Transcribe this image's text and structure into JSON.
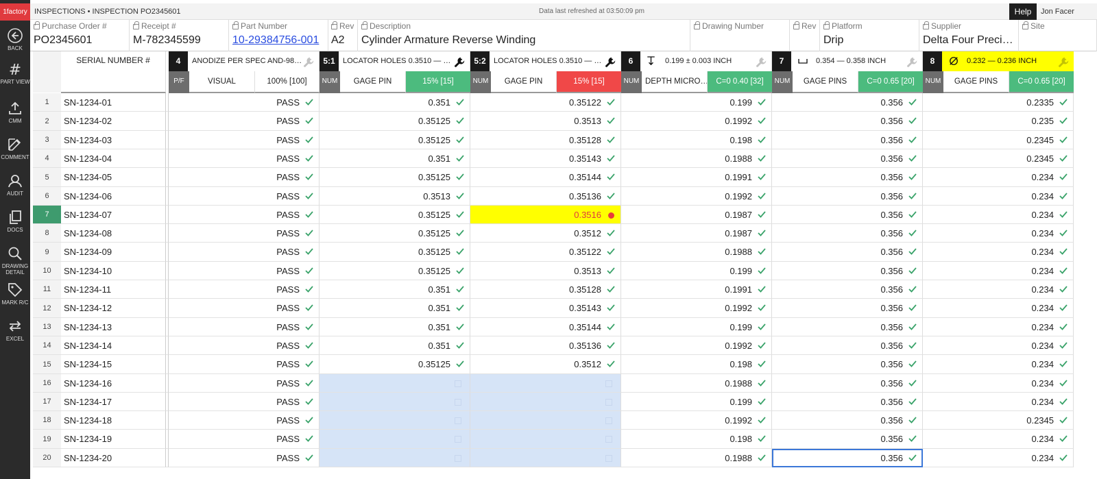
{
  "app": {
    "brand": "1factory"
  },
  "topbar": {
    "breadcrumb": "INSPECTIONS • INSPECTION PO2345601",
    "refresh": "Data last refreshed at 03:50:09 pm",
    "help": "Help",
    "user": "Jon Facer"
  },
  "rail": [
    {
      "label": "BACK",
      "icon": "back-arrow-icon"
    },
    {
      "label": "PART VIEW",
      "icon": "hash-icon"
    },
    {
      "label": "CMM",
      "icon": "upload-icon"
    },
    {
      "label": "COMMENT",
      "icon": "edit-icon"
    },
    {
      "label": "AUDIT",
      "icon": "user-icon"
    },
    {
      "label": "DOCS",
      "icon": "copy-icon"
    },
    {
      "label": "DRAWING DETAIL",
      "icon": "search-icon"
    },
    {
      "label": "MARK R/C",
      "icon": "tag-icon"
    },
    {
      "label": "EXCEL",
      "icon": "swap-icon"
    }
  ],
  "fields": [
    {
      "label": "Purchase Order #",
      "value": "PO2345601"
    },
    {
      "label": "Receipt #",
      "value": "M-782345599"
    },
    {
      "label": "Part Number",
      "value": "10-29384756-001"
    },
    {
      "label": "Rev",
      "value": "A2"
    },
    {
      "label": "Description",
      "value": "Cylinder Armature Reverse Winding"
    },
    {
      "label": "Drawing Number",
      "value": ""
    },
    {
      "label": "Rev",
      "value": ""
    },
    {
      "label": "Platform",
      "value": "Drip"
    },
    {
      "label": "Supplier",
      "value": "Delta Four Preci…"
    },
    {
      "label": "Site",
      "value": ""
    }
  ],
  "grid_header": {
    "serial": "SERIAL NUMBER #"
  },
  "columns": [
    {
      "num": "4",
      "spec": "ANODIZE PER SPEC AND-98…",
      "type": "P/F",
      "method": "VISUAL",
      "sample": "100% [100]",
      "status": "neutral"
    },
    {
      "num": "5:1",
      "spec": "LOCATOR HOLES 0.3510 — …",
      "type": "NUM",
      "method": "GAGE PIN",
      "sample": "15% [15]",
      "status": "good"
    },
    {
      "num": "5:2",
      "spec": "LOCATOR HOLES 0.3510 — …",
      "type": "NUM",
      "method": "GAGE PIN",
      "sample": "15% [15]",
      "status": "bad"
    },
    {
      "num": "6",
      "spec": "0.199 ± 0.003 INCH",
      "type": "NUM",
      "method": "DEPTH MICRO…",
      "sample": "C=0 0.40 [32]",
      "status": "good"
    },
    {
      "num": "7",
      "spec": "0.354 — 0.358 INCH",
      "type": "NUM",
      "method": "GAGE PINS",
      "sample": "C=0 0.65 [20]",
      "status": "good"
    },
    {
      "num": "8",
      "spec": "0.232 — 0.236 INCH",
      "type": "NUM",
      "method": "GAGE PINS",
      "sample": "C=0 0.65 [20]",
      "status": "good"
    }
  ],
  "rows": [
    {
      "n": "1",
      "serial": "SN-1234-01",
      "v": [
        "PASS",
        "0.351",
        "0.35122",
        "0.199",
        "0.356",
        "0.2335"
      ]
    },
    {
      "n": "2",
      "serial": "SN-1234-02",
      "v": [
        "PASS",
        "0.35125",
        "0.3513",
        "0.1992",
        "0.356",
        "0.235"
      ]
    },
    {
      "n": "3",
      "serial": "SN-1234-03",
      "v": [
        "PASS",
        "0.35125",
        "0.35128",
        "0.198",
        "0.356",
        "0.2345"
      ]
    },
    {
      "n": "4",
      "serial": "SN-1234-04",
      "v": [
        "PASS",
        "0.351",
        "0.35143",
        "0.1988",
        "0.356",
        "0.2345"
      ]
    },
    {
      "n": "5",
      "serial": "SN-1234-05",
      "v": [
        "PASS",
        "0.35125",
        "0.35144",
        "0.1991",
        "0.356",
        "0.234"
      ]
    },
    {
      "n": "6",
      "serial": "SN-1234-06",
      "v": [
        "PASS",
        "0.3513",
        "0.35136",
        "0.1992",
        "0.356",
        "0.234"
      ]
    },
    {
      "n": "7",
      "serial": "SN-1234-07",
      "v": [
        "PASS",
        "0.35125",
        "0.3516",
        "0.1987",
        "0.356",
        "0.234"
      ]
    },
    {
      "n": "8",
      "serial": "SN-1234-08",
      "v": [
        "PASS",
        "0.35125",
        "0.3512",
        "0.1987",
        "0.356",
        "0.234"
      ]
    },
    {
      "n": "9",
      "serial": "SN-1234-09",
      "v": [
        "PASS",
        "0.35125",
        "0.35122",
        "0.1988",
        "0.356",
        "0.234"
      ]
    },
    {
      "n": "10",
      "serial": "SN-1234-10",
      "v": [
        "PASS",
        "0.35125",
        "0.3513",
        "0.199",
        "0.356",
        "0.234"
      ]
    },
    {
      "n": "11",
      "serial": "SN-1234-11",
      "v": [
        "PASS",
        "0.351",
        "0.35128",
        "0.1991",
        "0.356",
        "0.234"
      ]
    },
    {
      "n": "12",
      "serial": "SN-1234-12",
      "v": [
        "PASS",
        "0.351",
        "0.35143",
        "0.1992",
        "0.356",
        "0.234"
      ]
    },
    {
      "n": "13",
      "serial": "SN-1234-13",
      "v": [
        "PASS",
        "0.351",
        "0.35144",
        "0.199",
        "0.356",
        "0.234"
      ]
    },
    {
      "n": "14",
      "serial": "SN-1234-14",
      "v": [
        "PASS",
        "0.351",
        "0.35136",
        "0.1992",
        "0.356",
        "0.234"
      ]
    },
    {
      "n": "15",
      "serial": "SN-1234-15",
      "v": [
        "PASS",
        "0.35125",
        "0.3512",
        "0.198",
        "0.356",
        "0.234"
      ]
    },
    {
      "n": "16",
      "serial": "SN-1234-16",
      "v": [
        "PASS",
        "",
        "",
        "0.1988",
        "0.356",
        "0.234"
      ]
    },
    {
      "n": "17",
      "serial": "SN-1234-17",
      "v": [
        "PASS",
        "",
        "",
        "0.199",
        "0.356",
        "0.234"
      ]
    },
    {
      "n": "18",
      "serial": "SN-1234-18",
      "v": [
        "PASS",
        "",
        "",
        "0.1992",
        "0.356",
        "0.2345"
      ]
    },
    {
      "n": "19",
      "serial": "SN-1234-19",
      "v": [
        "PASS",
        "",
        "",
        "0.198",
        "0.356",
        "0.234"
      ]
    },
    {
      "n": "20",
      "serial": "SN-1234-20",
      "v": [
        "PASS",
        "",
        "",
        "0.1988",
        "0.356",
        "0.234"
      ]
    }
  ],
  "selected_row": "7",
  "failed_cell": {
    "row": "7",
    "column": "5:2"
  },
  "focused_cell": {
    "row": "20",
    "column": "7"
  },
  "colors": {
    "brand": "#e03a3e",
    "pass": "#4cbb7e",
    "fail": "#f04848",
    "highlight": "#ffff00",
    "pending": "#d6e4f7"
  }
}
